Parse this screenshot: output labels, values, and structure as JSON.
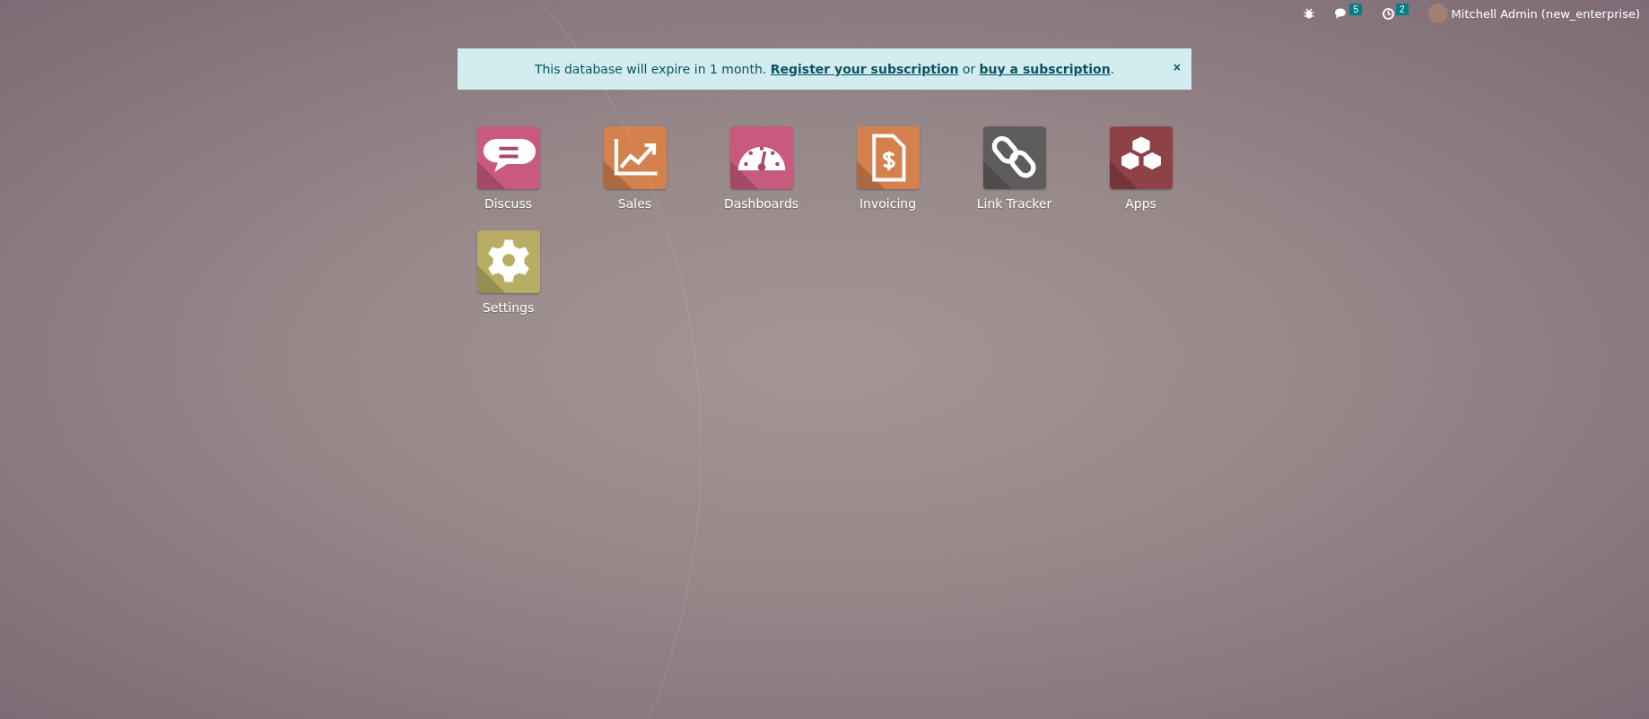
{
  "top_bar": {
    "message_count": "5",
    "activity_count": "2",
    "user_name": "Mitchell Admin (new_enterprise)"
  },
  "banner": {
    "text": "This database will expire in 1 month. ",
    "link_register": "Register your subscription",
    "middle": " or ",
    "link_buy": "buy a subscription",
    "end": ".",
    "close": "×"
  },
  "apps": [
    {
      "label": "Discuss",
      "kind": "chat",
      "color": "#c85a7e"
    },
    {
      "label": "Sales",
      "kind": "chart",
      "color": "#d4814e"
    },
    {
      "label": "Dashboards",
      "kind": "gauge",
      "color": "#c85a7e"
    },
    {
      "label": "Invoicing",
      "kind": "invoice",
      "color": "#d4814e"
    },
    {
      "label": "Link Tracker",
      "kind": "link",
      "color": "#5e5d5b"
    },
    {
      "label": "Apps",
      "kind": "cubes",
      "color": "#8e4248"
    },
    {
      "label": "Settings",
      "kind": "gear",
      "color": "#b8ad64"
    }
  ]
}
